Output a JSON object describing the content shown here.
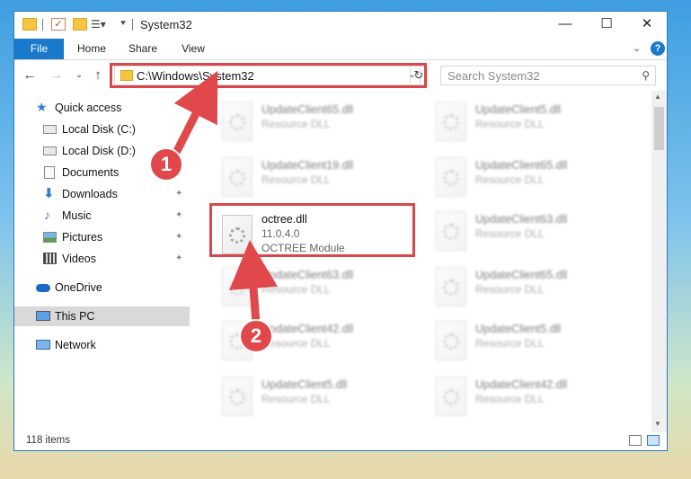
{
  "window": {
    "title": "System32",
    "controls": {
      "minimize": "—",
      "maximize": "☐",
      "close": "✕"
    }
  },
  "ribbon": {
    "tabs": [
      "File",
      "Home",
      "Share",
      "View"
    ],
    "collapse_chevron": "⌄",
    "help": "?"
  },
  "navigation": {
    "back": "←",
    "forward": "→",
    "recent": "⌄",
    "up": "↑",
    "address": "C:\\Windows\\System32",
    "refresh": "↻",
    "search_placeholder": "Search System32"
  },
  "sidebar": {
    "items": [
      {
        "label": "Quick access",
        "icon": "star-icon"
      },
      {
        "label": "Local Disk (C:)",
        "icon": "drive-icon"
      },
      {
        "label": "Local Disk (D:)",
        "icon": "drive-icon"
      },
      {
        "label": "Documents",
        "icon": "documents-icon"
      },
      {
        "label": "Downloads",
        "icon": "download-icon",
        "pinned": true
      },
      {
        "label": "Music",
        "icon": "music-icon",
        "pinned": true
      },
      {
        "label": "Pictures",
        "icon": "pictures-icon",
        "pinned": true
      },
      {
        "label": "Videos",
        "icon": "videos-icon",
        "pinned": true
      },
      {
        "label": "OneDrive",
        "icon": "cloud-icon"
      },
      {
        "label": "This PC",
        "icon": "computer-icon",
        "selected": true
      },
      {
        "label": "Network",
        "icon": "network-icon"
      }
    ],
    "pin_glyph": "📌"
  },
  "files": [
    {
      "name": "UpdateClient65.dll",
      "desc": "Resource DLL",
      "blurred": true
    },
    {
      "name": "UpdateClient5.dll",
      "desc": "Resource DLL",
      "blurred": true
    },
    {
      "name": "UpdateClient19.dll",
      "desc": "Resource DLL",
      "blurred": true
    },
    {
      "name": "UpdateClient65.dll",
      "desc": "Resource DLL",
      "blurred": true
    },
    {
      "name": "octree.dll",
      "version": "11.0.4.0",
      "desc": "OCTREE Module",
      "blurred": false
    },
    {
      "name": "UpdateClient63.dll",
      "desc": "Resource DLL",
      "blurred": true
    },
    {
      "name": "UpdateClient63.dll",
      "desc": "Resource DLL",
      "blurred": true
    },
    {
      "name": "UpdateClient65.dll",
      "desc": "Resource DLL",
      "blurred": true
    },
    {
      "name": "UpdateClient42.dll",
      "desc": "Resource DLL",
      "blurred": true
    },
    {
      "name": "UpdateClient5.dll",
      "desc": "Resource DLL",
      "blurred": true
    },
    {
      "name": "UpdateClient5.dll",
      "desc": "Resource DLL",
      "blurred": true
    },
    {
      "name": "UpdateClient42.dll",
      "desc": "Resource DLL",
      "blurred": true
    }
  ],
  "status": {
    "item_count": "118 items"
  },
  "callouts": [
    "1",
    "2"
  ],
  "colors": {
    "accent": "#1979ca",
    "highlight": "#d9474b",
    "selected": "#d9d9d9"
  }
}
